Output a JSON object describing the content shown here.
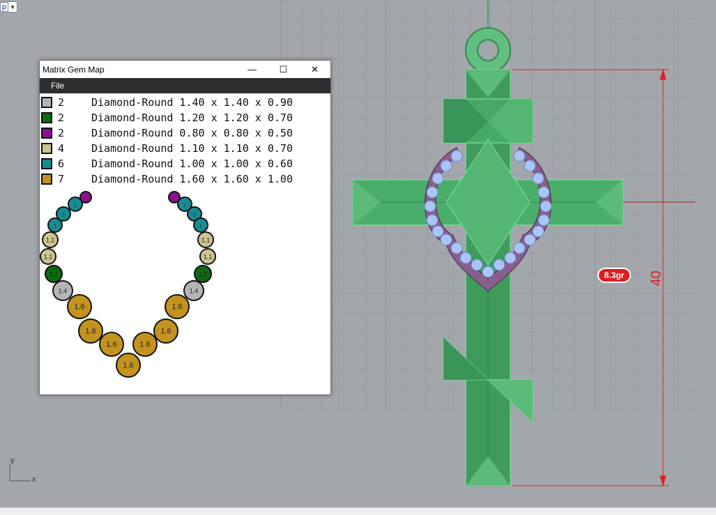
{
  "viewport": {
    "view_name": "p",
    "weight_label": "8.3gr",
    "dimension_label": "40",
    "axis_x_label": "x",
    "axis_y_label": "y",
    "colors": {
      "background": "#a3a7ab",
      "model_green": "#4cae6a",
      "dimension_red": "#e02020",
      "bezel": "#8a5f8c",
      "gem_blue": "#a9c4f5"
    }
  },
  "gem_window": {
    "title": "Matrix Gem Map",
    "menu": {
      "file": "File"
    },
    "controls": {
      "minimize": "—",
      "maximize": "☐",
      "close": "✕"
    },
    "gems": [
      {
        "count": "2",
        "description": "Diamond-Round 1.40 x 1.40 x 0.90",
        "color": "#b4b4b4"
      },
      {
        "count": "2",
        "description": "Diamond-Round 1.20 x 1.20 x 0.70",
        "color": "#0d6a12"
      },
      {
        "count": "2",
        "description": "Diamond-Round 0.80 x 0.80 x 0.50",
        "color": "#8c128c"
      },
      {
        "count": "4",
        "description": "Diamond-Round 1.10 x 1.10 x 0.70",
        "color": "#cfc38f"
      },
      {
        "count": "6",
        "description": "Diamond-Round 1.00 x 1.00 x 0.60",
        "color": "#168b92"
      },
      {
        "count": "7",
        "description": "Diamond-Round 1.60 x 1.60 x 1.00",
        "color": "#c4931f"
      }
    ],
    "map_labels": {
      "size_1_6": "1.6",
      "size_1_4": "1.4",
      "size_1_2": "1.2",
      "size_1_1": "1.1",
      "size_1": "1"
    }
  }
}
